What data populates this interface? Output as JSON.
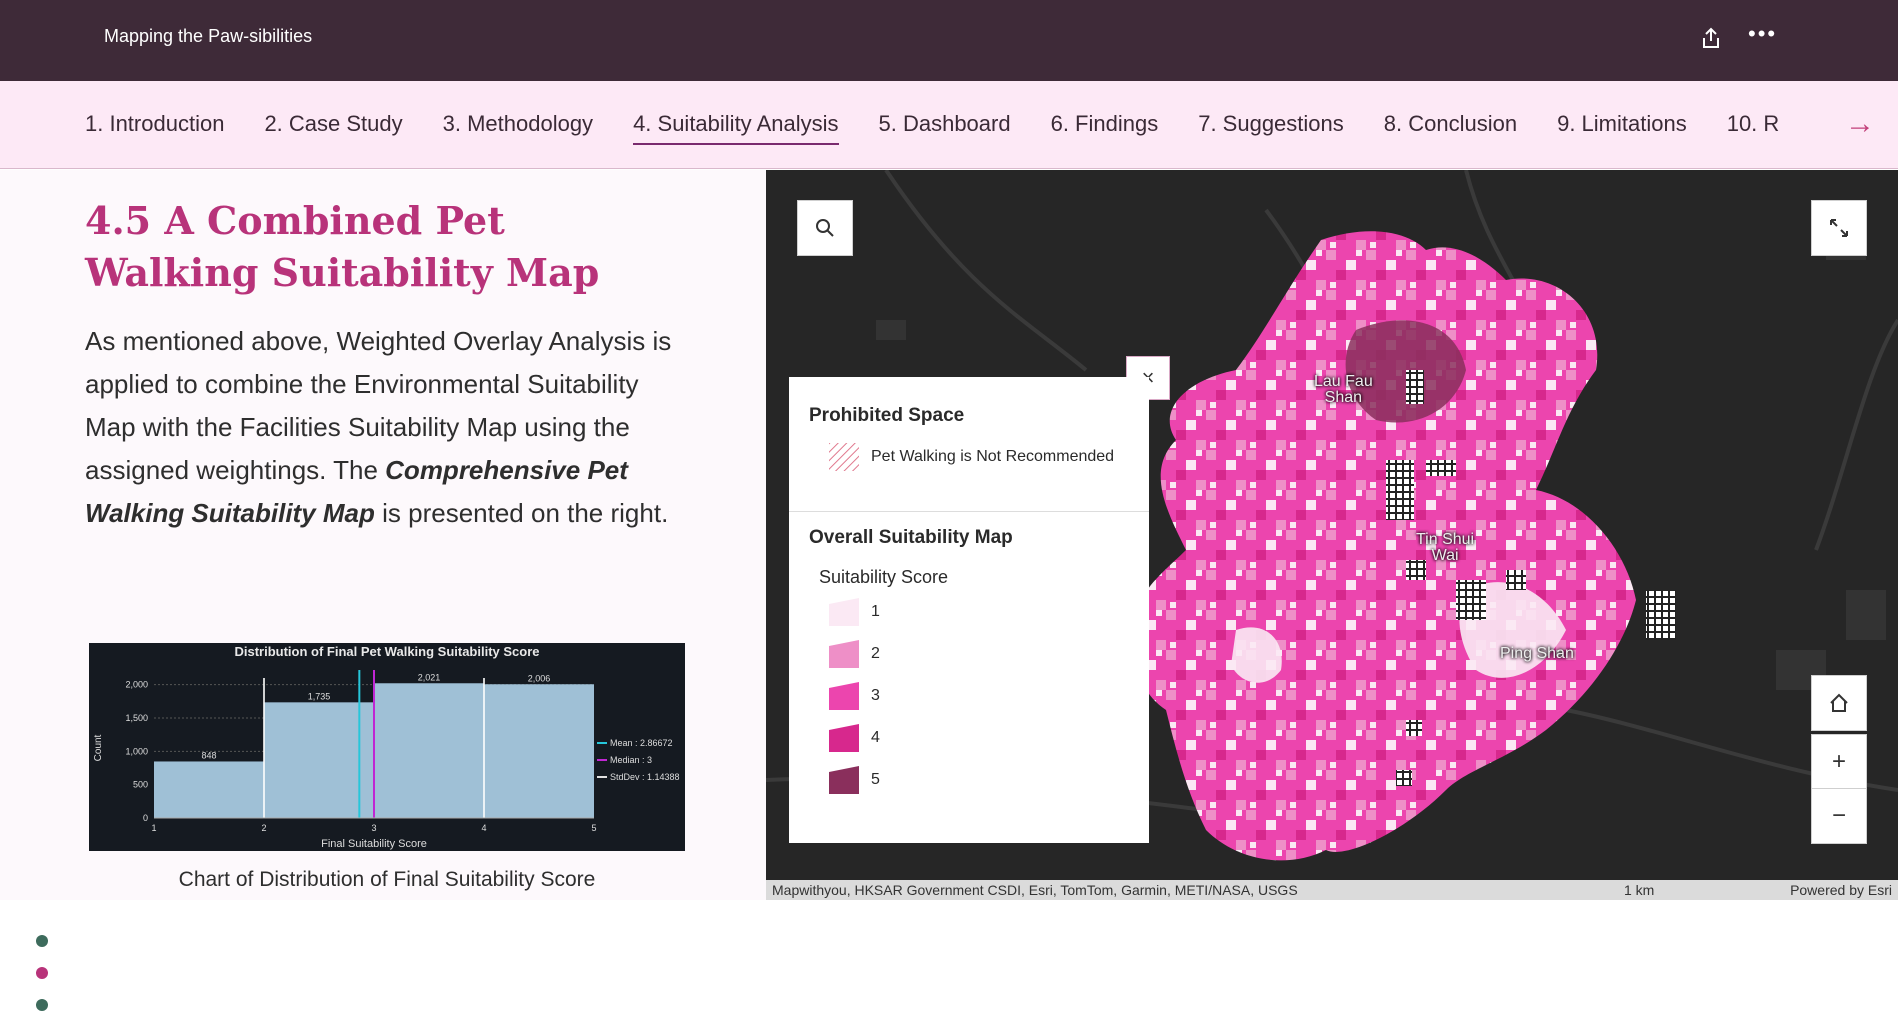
{
  "header": {
    "title": "Mapping the Paw-sibilities",
    "share_icon": "share-icon",
    "more_icon": "more-icon"
  },
  "nav": {
    "tabs": [
      {
        "label": "1. Introduction"
      },
      {
        "label": "2. Case Study"
      },
      {
        "label": "3. Methodology"
      },
      {
        "label": "4. Suitability Analysis",
        "active": true
      },
      {
        "label": "5. Dashboard"
      },
      {
        "label": "6. Findings"
      },
      {
        "label": "7. Suggestions"
      },
      {
        "label": "8. Conclusion"
      },
      {
        "label": "9. Limitations"
      },
      {
        "label": "10. R"
      }
    ],
    "next_label": "→"
  },
  "section": {
    "heading": "4.5 A Combined Pet Walking Suitability Map",
    "para_before": "As mentioned above, Weighted Overlay Analysis is applied to combine the Environmental Suitability Map with the Facilities Suitability Map using the assigned weightings. The ",
    "para_emphasis": "Comprehensive Pet Walking Suitability Map",
    "para_after": " is presented on the right.",
    "caption": "Chart of Distribution of Final Suitability Score"
  },
  "chart_data": {
    "type": "bar",
    "title": "Distribution of Final Pet Walking Suitability Score",
    "xlabel": "Final Suitability Score",
    "ylabel": "Count",
    "x_ticks": [
      "1",
      "2",
      "3",
      "4",
      "5"
    ],
    "y_ticks": [
      "0",
      "500",
      "1,000",
      "1,500",
      "2,000"
    ],
    "ylim": [
      0,
      2100
    ],
    "bins": [
      {
        "from": 1,
        "to": 2,
        "value": 848,
        "label": "848"
      },
      {
        "from": 2,
        "to": 3,
        "value": 1735,
        "label": "1,735"
      },
      {
        "from": 3,
        "to": 4,
        "value": 2021,
        "label": "2,021"
      },
      {
        "from": 4,
        "to": 5,
        "value": 2006,
        "label": "2,006"
      }
    ],
    "stats": [
      {
        "label": "Mean : 2.86672",
        "value": 2.86672,
        "color": "#26c6da"
      },
      {
        "label": "Median : 3",
        "value": 3,
        "color": "#c026d3"
      },
      {
        "label": "StdDev : 1.14388",
        "value": 1.14388,
        "color": "#e0e0e0"
      }
    ],
    "grid": true,
    "legend_position": "right",
    "bar_color": "#9fc0d6",
    "background": "#151a21"
  },
  "map": {
    "labels": [
      {
        "text": "Lau Fau Shan",
        "lines": [
          "Lau Fau",
          "Shan"
        ]
      },
      {
        "text": "Tin Shui Wai",
        "lines": [
          "Tin Shui",
          "Wai"
        ]
      },
      {
        "text": "Ping Shan",
        "lines": [
          "Ping Shan"
        ]
      }
    ],
    "attribution": "Mapwithyou, HKSAR Government CSDI, Esri, TomTom, Garmin, METI/NASA, USGS",
    "scale": "1 km",
    "powered": "Powered by Esri",
    "buttons": {
      "search": "search-icon",
      "fullscreen": "expand-icon",
      "home": "home-icon",
      "zoom_in": "+",
      "zoom_out": "−",
      "close": "×"
    }
  },
  "legend": {
    "prohibited_title": "Prohibited Space",
    "prohibited_item": "Pet Walking is Not Recommended",
    "overall_title": "Overall Suitability Map",
    "score_title": "Suitability Score",
    "scores": [
      {
        "label": "1",
        "color": "#fbe9f4"
      },
      {
        "label": "2",
        "color": "#ee8fc7"
      },
      {
        "label": "3",
        "color": "#ec45ae"
      },
      {
        "label": "4",
        "color": "#d7288d"
      },
      {
        "label": "5",
        "color": "#8a2f5c"
      }
    ]
  },
  "dots": [
    {
      "color": "#3d6b5c"
    },
    {
      "color": "#b8337a"
    },
    {
      "color": "#3d6b5c"
    }
  ]
}
